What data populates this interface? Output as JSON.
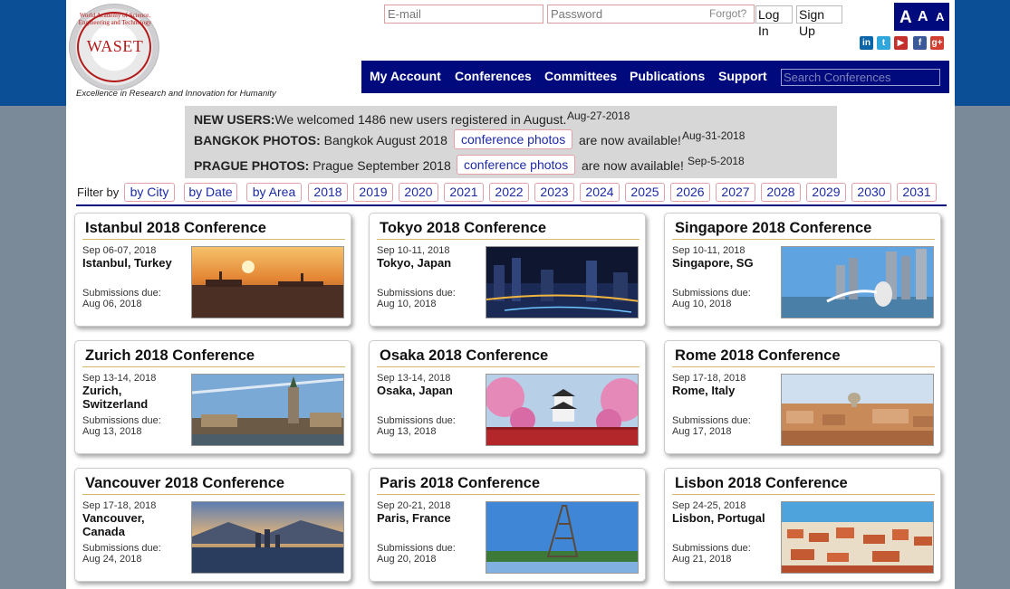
{
  "header": {
    "logo_text": "WASET",
    "logo_ring_text": "World Academy of Science, Engineering and Technology",
    "tagline": "Excellence in Research and Innovation for Humanity",
    "email_placeholder": "E-mail",
    "password_placeholder": "Password",
    "forgot_label": "Forgot?",
    "login_label": "Log In",
    "signup_label": "Sign Up",
    "font_sizes": [
      "A",
      "A",
      "A"
    ],
    "social": [
      "in",
      "t",
      "▶",
      "f",
      "g+"
    ]
  },
  "nav": {
    "items": [
      "My Account",
      "Conferences",
      "Committees",
      "Publications",
      "Support"
    ],
    "search_placeholder": "Search Conferences"
  },
  "announcements": [
    {
      "label": "NEW USERS:",
      "text": "We welcomed 1486 new users registered in August.",
      "date": "Aug-27-2018"
    },
    {
      "label": "BANGKOK PHOTOS:",
      "text": "Bangkok August 2018",
      "button": "conference photos",
      "suffix": "are now available!",
      "date": "Aug-31-2018"
    },
    {
      "label": "PRAGUE PHOTOS:",
      "text": "Prague September 2018",
      "button": "conference photos",
      "suffix": "are now available!",
      "date": "Sep-5-2018"
    }
  ],
  "filter": {
    "label": "Filter by",
    "options": [
      "by City",
      "by Date",
      "by Area",
      "2018",
      "2019",
      "2020",
      "2021",
      "2022",
      "2023",
      "2024",
      "2025",
      "2026",
      "2027",
      "2028",
      "2029",
      "2030",
      "2031"
    ]
  },
  "conferences": [
    {
      "title": "Istanbul 2018 Conference",
      "dates": "Sep 06-07, 2018",
      "city": "Istanbul, Turkey",
      "due_label": "Submissions due:",
      "due": "Aug 06, 2018",
      "image": "istanbul-sunset"
    },
    {
      "title": "Tokyo 2018 Conference",
      "dates": "Sep 10-11, 2018",
      "city": "Tokyo, Japan",
      "due_label": "Submissions due:",
      "due": "Aug 10, 2018",
      "image": "tokyo-night"
    },
    {
      "title": "Singapore 2018 Conference",
      "dates": "Sep 10-11, 2018",
      "city": "Singapore, SG",
      "due_label": "Submissions due:",
      "due": "Aug 10, 2018",
      "image": "singapore-merlion"
    },
    {
      "title": "Zurich 2018 Conference",
      "dates": "Sep 13-14, 2018",
      "city": "Zurich, Switzerland",
      "due_label": "Submissions due:",
      "due": "Aug 13, 2018",
      "image": "zurich-church"
    },
    {
      "title": "Osaka 2018 Conference",
      "dates": "Sep 13-14, 2018",
      "city": "Osaka, Japan",
      "due_label": "Submissions due:",
      "due": "Aug 13, 2018",
      "image": "osaka-castle"
    },
    {
      "title": "Rome 2018 Conference",
      "dates": "Sep 17-18, 2018",
      "city": "Rome, Italy",
      "due_label": "Submissions due:",
      "due": "Aug 17, 2018",
      "image": "rome-skyline"
    },
    {
      "title": "Vancouver 2018 Conference",
      "dates": "Sep 17-18, 2018",
      "city": "Vancouver, Canada",
      "due_label": "Submissions due:",
      "due": "Aug 24, 2018",
      "image": "vancouver-harbor"
    },
    {
      "title": "Paris 2018 Conference",
      "dates": "Sep 20-21, 2018",
      "city": "Paris, France",
      "due_label": "Submissions due:",
      "due": "Aug 20, 2018",
      "image": "paris-eiffel"
    },
    {
      "title": "Lisbon 2018 Conference",
      "dates": "Sep 24-25, 2018",
      "city": "Lisbon, Portugal",
      "due_label": "Submissions due:",
      "due": "Aug 21, 2018",
      "image": "lisbon-rooftops"
    }
  ],
  "colors": {
    "nav_bg": "#000a7d",
    "top_band": "#0b4f96",
    "announce_bg": "#d7d7d7",
    "pill_border": "#e2a0a8",
    "pill_text": "#1d2aa8",
    "card_rule": "#d8b86a"
  }
}
